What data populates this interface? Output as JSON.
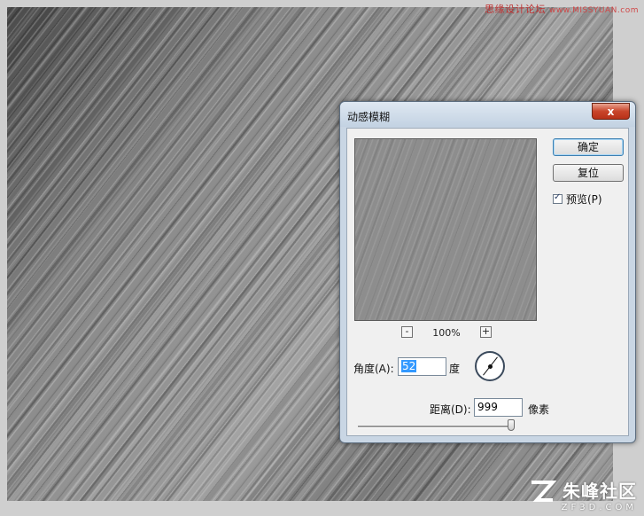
{
  "watermark": {
    "cn": "思缘设计论坛",
    "site": "www.MISSYUAN.com"
  },
  "logo": {
    "cn": "朱峰社区",
    "en": "ZF3D.COM"
  },
  "dialog": {
    "title": "动感模糊",
    "close_label": "x",
    "ok_label": "确定",
    "reset_label": "复位",
    "preview_label": "预览(P)",
    "preview_checked": true,
    "zoom": {
      "minus": "-",
      "plus": "+",
      "level": "100%"
    },
    "angle": {
      "label": "角度(A):",
      "value": "52",
      "unit": "度"
    },
    "distance": {
      "label": "距离(D):",
      "value": "999",
      "unit": "像素",
      "slider_fraction": 1.0
    }
  },
  "colors": {
    "accent": "#3399ff",
    "close": "#c9452b",
    "frame": "#c9d6e4"
  }
}
